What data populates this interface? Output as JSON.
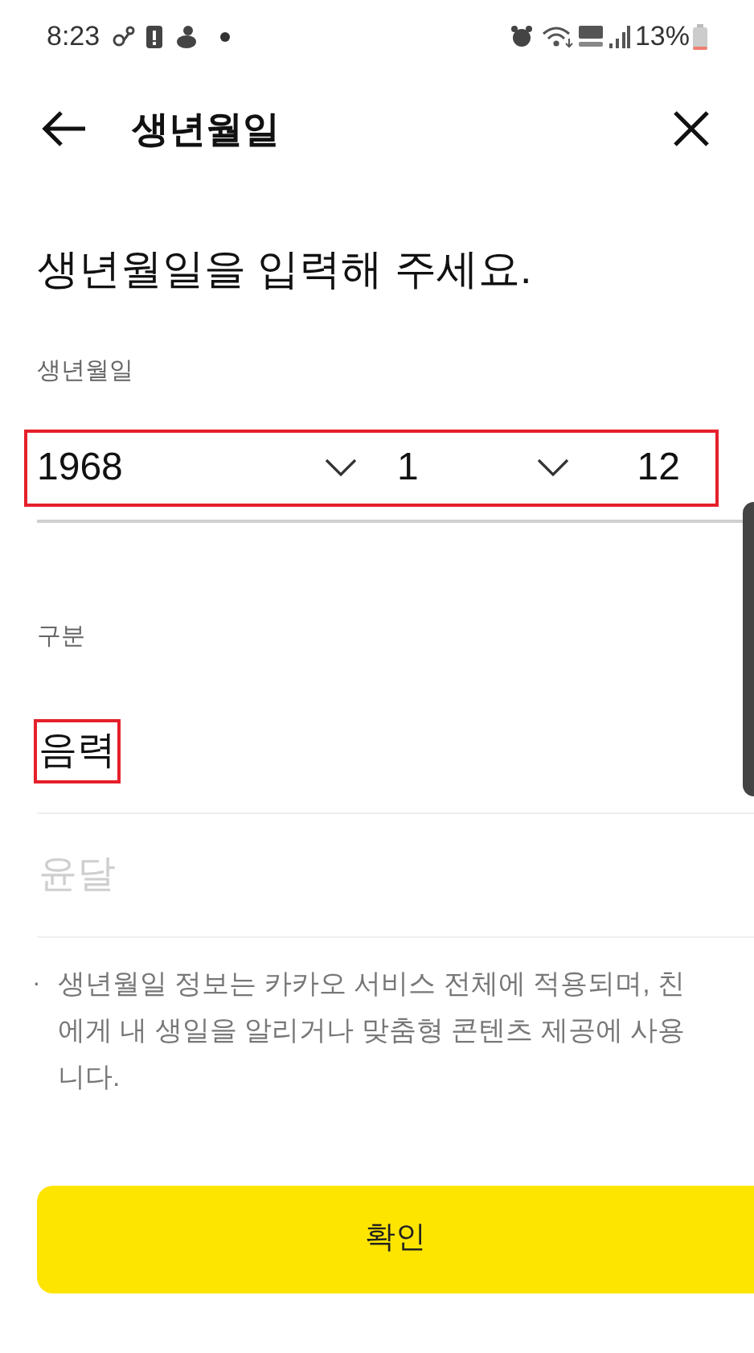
{
  "status_bar": {
    "time": "8:23",
    "battery": "13%"
  },
  "header": {
    "title": "생년월일"
  },
  "heading": "생년월일을 입력해 주세요.",
  "birth_date": {
    "label": "생년월일",
    "year": "1968",
    "month": "1",
    "day": "12",
    "highlighted": true
  },
  "type": {
    "label": "구분",
    "options": [
      {
        "label": "음력",
        "selected": true,
        "highlighted": true
      },
      {
        "label": "윤달",
        "selected": false,
        "highlighted": false
      }
    ]
  },
  "note": {
    "bullet": "·",
    "lines": [
      "생년월일 정보는 카카오 서비스 전체에 적용되며, 친",
      "에게 내 생일을 알리거나 맞춤형 콘텐츠 제공에 사용",
      "니다."
    ]
  },
  "confirm_button": "확인"
}
